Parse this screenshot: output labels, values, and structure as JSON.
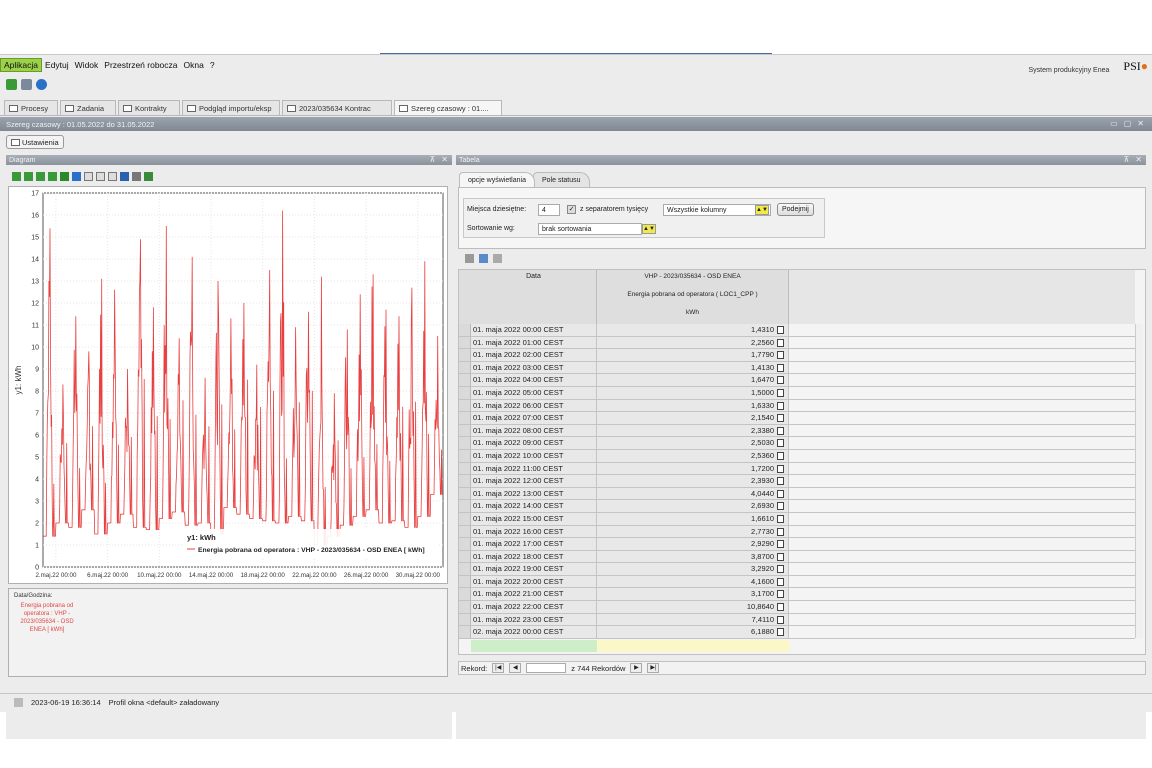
{
  "menu": [
    "Aplikacja",
    "Edytuj",
    "Widok",
    "Przestrzeń robocza",
    "Okna",
    "?"
  ],
  "brand": {
    "subtitle": "System produkcyjny Enea",
    "logo": "PSI"
  },
  "tabs": [
    "Procesy",
    "Zadania",
    "Kontrakty",
    "Podgląd importu/eksp",
    "2023/035634   Kontrac",
    "Szereg czasowy : 01...."
  ],
  "title_strip": "Szereg czasowy : 01.05.2022 do 31.05.2022",
  "settings_label": "Ustawienia",
  "diagram": {
    "pane_title": "Diagram",
    "legend_axis": "y1: kWh",
    "legend_series": "Energia pobrana od operatora : VHP - 2023/035634 - OSD ENEA [ kWh]",
    "info_label": "Data/Godzina:",
    "info_series": "Energia pobrana od operatora : VHP - 2023/035634 - OSD ENEA [ kWh]"
  },
  "chart_data": {
    "type": "line",
    "ylabel": "y1: kWh",
    "ylim": [
      0,
      17
    ],
    "yticks": [
      0,
      1,
      2,
      3,
      4,
      5,
      6,
      7,
      8,
      9,
      10,
      11,
      12,
      13,
      14,
      15,
      16,
      17
    ],
    "xticks": [
      "2.maj.22 00:00",
      "6.maj.22 00:00",
      "10.maj.22 00:00",
      "14.maj.22 00:00",
      "18.maj.22 00:00",
      "22.maj.22 00:00",
      "26.maj.22 00:00",
      "30.maj.22 00:00"
    ],
    "xrange_days": [
      1,
      31
    ],
    "series": [
      {
        "name": "Energia pobrana od operatora : VHP - 2023/035634 - OSD ENEA [ kWh]",
        "color": "#e84040",
        "daily_peaks": [
          15.4,
          8.3,
          11.4,
          9.8,
          13.1,
          12.6,
          9.0,
          14.9,
          11.8,
          15.5,
          10.4,
          14.1,
          8.6,
          13.0,
          11.3,
          12.0,
          9.2,
          13.5,
          16.2,
          10.9,
          11.6,
          13.2,
          7.9,
          10.8,
          12.4,
          13.3,
          11.7,
          11.4,
          12.7,
          13.9,
          10.5
        ],
        "daily_lows": [
          1.4,
          2.0,
          1.8,
          2.6,
          1.5,
          2.0,
          2.4,
          1.8,
          1.7,
          2.2,
          2.5,
          1.9,
          2.0,
          1.5,
          2.7,
          2.4,
          2.2,
          2.1,
          2.0,
          2.3,
          2.1,
          1.0,
          1.4,
          1.9,
          2.3,
          2.6,
          2.0,
          2.1,
          1.8,
          2.3,
          3.3
        ]
      }
    ]
  },
  "table_pane": {
    "title": "Tabela",
    "subtabs": [
      "opcje wyświetlania",
      "Pole statusu"
    ],
    "decimals_label": "Miejsca dziesiętne:",
    "decimals_value": "4",
    "separator_label": "z separatorem tysięcy",
    "columns_value": "Wszystkie kolumny",
    "apply_button": "Podejmij",
    "sort_label": "Sortowanie wg:",
    "sort_value": "brak sortowania",
    "header_date": "Data",
    "header_series": "VHP - 2023/035634 - OSD ENEA",
    "header_measure": "Energia pobrana od operatora ( LOC1_CPP )",
    "header_unit": "kWh",
    "rows": [
      {
        "date": "01. maja 2022 00:00 CEST",
        "value": "1,4310"
      },
      {
        "date": "01. maja 2022 01:00 CEST",
        "value": "2,2560"
      },
      {
        "date": "01. maja 2022 02:00 CEST",
        "value": "1,7790"
      },
      {
        "date": "01. maja 2022 03:00 CEST",
        "value": "1,4130"
      },
      {
        "date": "01. maja 2022 04:00 CEST",
        "value": "1,6470"
      },
      {
        "date": "01. maja 2022 05:00 CEST",
        "value": "1,5000"
      },
      {
        "date": "01. maja 2022 06:00 CEST",
        "value": "1,6330"
      },
      {
        "date": "01. maja 2022 07:00 CEST",
        "value": "2,1540"
      },
      {
        "date": "01. maja 2022 08:00 CEST",
        "value": "2,3380"
      },
      {
        "date": "01. maja 2022 09:00 CEST",
        "value": "2,5030"
      },
      {
        "date": "01. maja 2022 10:00 CEST",
        "value": "2,5360"
      },
      {
        "date": "01. maja 2022 11:00 CEST",
        "value": "1,7200"
      },
      {
        "date": "01. maja 2022 12:00 CEST",
        "value": "2,3930"
      },
      {
        "date": "01. maja 2022 13:00 CEST",
        "value": "4,0440"
      },
      {
        "date": "01. maja 2022 14:00 CEST",
        "value": "2,6930"
      },
      {
        "date": "01. maja 2022 15:00 CEST",
        "value": "1,6610"
      },
      {
        "date": "01. maja 2022 16:00 CEST",
        "value": "2,7730"
      },
      {
        "date": "01. maja 2022 17:00 CEST",
        "value": "2,9290"
      },
      {
        "date": "01. maja 2022 18:00 CEST",
        "value": "3,8700"
      },
      {
        "date": "01. maja 2022 19:00 CEST",
        "value": "3,2920"
      },
      {
        "date": "01. maja 2022 20:00 CEST",
        "value": "4,1600"
      },
      {
        "date": "01. maja 2022 21:00 CEST",
        "value": "3,1700"
      },
      {
        "date": "01. maja 2022 22:00 CEST",
        "value": "10,8640"
      },
      {
        "date": "01. maja 2022 23:00 CEST",
        "value": "7,4110"
      },
      {
        "date": "02. maja 2022 00:00 CEST",
        "value": "6,1880"
      }
    ],
    "pager_label": "Rekord:",
    "pager_total": "z 744  Rekordów"
  },
  "status": {
    "timestamp": "2023-06-19 16:36:14",
    "message": "Profil okna <default> załadowany"
  },
  "colors": {
    "accent_menu": "#9cd14a",
    "series": "#e84040",
    "drop_button": "#f2ea4a"
  }
}
